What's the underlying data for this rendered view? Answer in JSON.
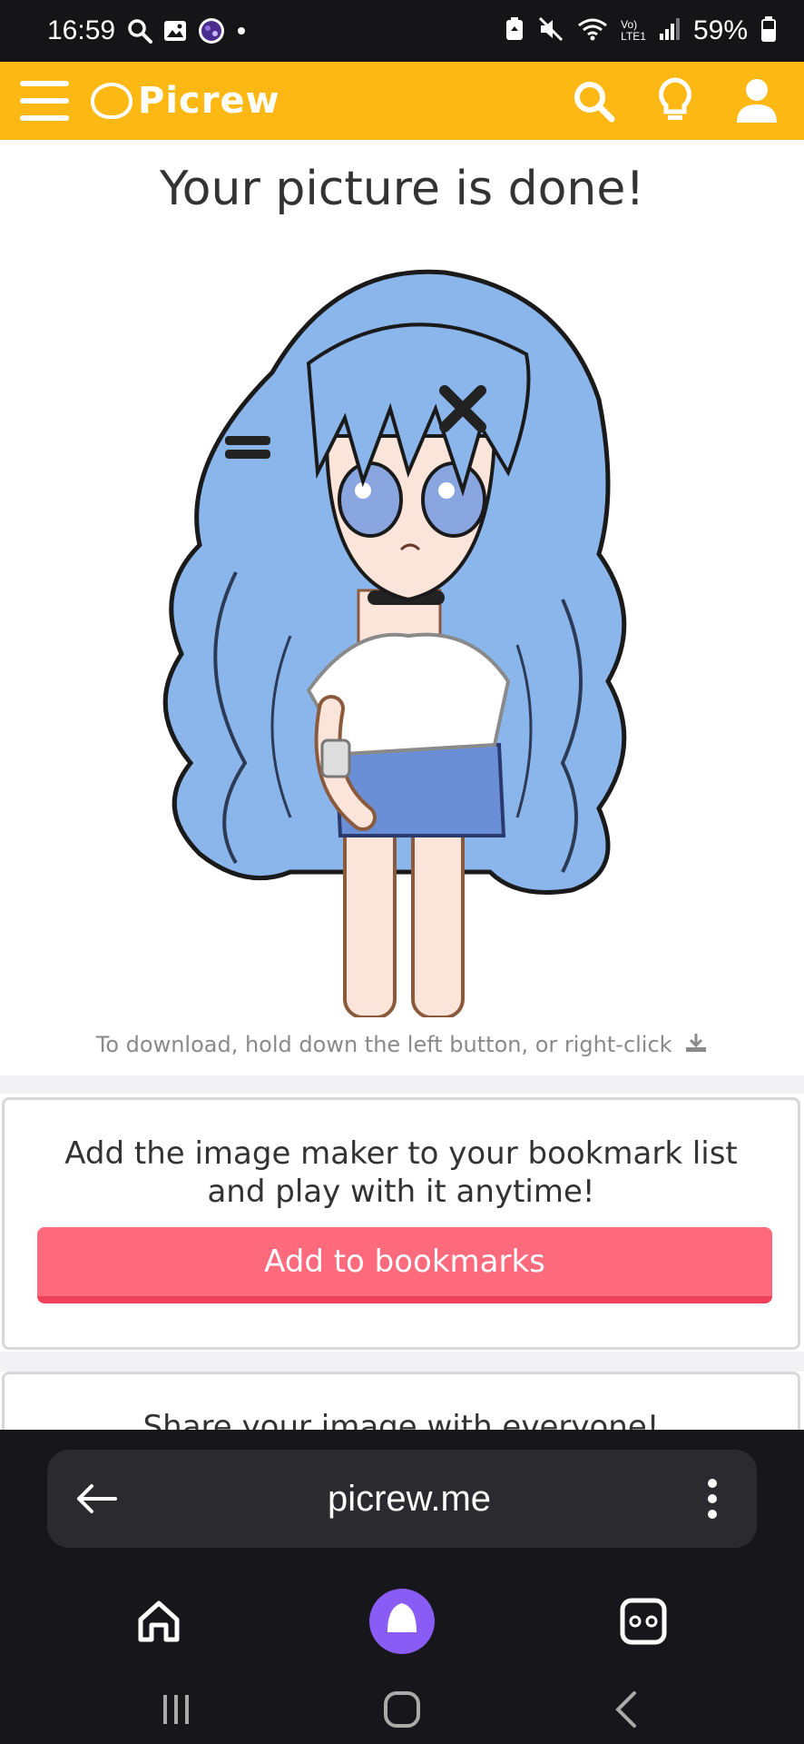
{
  "status_bar": {
    "time": "16:59",
    "battery_percent": "59%",
    "icons": [
      "search-icon",
      "gallery-icon",
      "app-icon",
      "dot-icon",
      "battery-saver-icon",
      "mute-icon",
      "wifi-icon",
      "volte-icon",
      "signal-icon",
      "battery-icon"
    ],
    "network_label_top": "Vo)",
    "network_label_bottom": "LTE1"
  },
  "app_bar": {
    "logo_text": "Picrew",
    "icons": [
      "menu-icon",
      "search-icon",
      "lightbulb-icon",
      "user-icon"
    ],
    "color": "#fdb813"
  },
  "main": {
    "title": "Your picture is done!",
    "download_hint": "To download, hold down the left button, or right-click",
    "bookmark_card": {
      "text": "Add the image maker to your bookmark list and play with it anytime!",
      "button_label": "Add to bookmarks",
      "button_color": "#ff6b7d"
    },
    "share_card": {
      "text": "Share your image with everyone!"
    }
  },
  "browser": {
    "url": "picrew.me",
    "nav_icons": [
      "back-arrow-icon",
      "more-icon",
      "home-icon",
      "assistant-icon",
      "tabs-icon"
    ],
    "system_icons": [
      "recents-icon",
      "home-button-icon",
      "back-icon"
    ]
  }
}
